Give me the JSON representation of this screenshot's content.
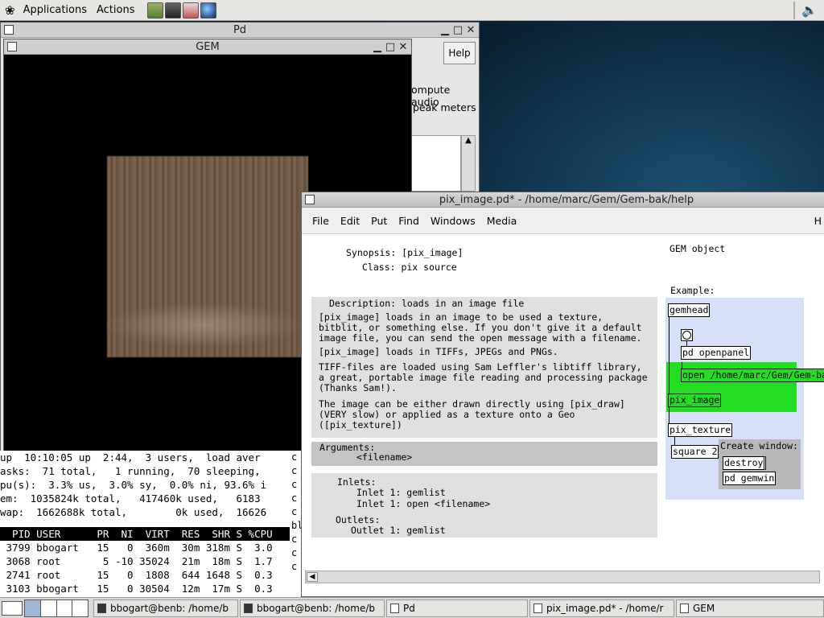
{
  "top_panel": {
    "applications": "Applications",
    "actions": "Actions",
    "launchers": [
      "notes-icon",
      "terminal-icon",
      "printer-icon",
      "globe-icon"
    ],
    "volume_icon": "speaker-icon"
  },
  "pd_window": {
    "title": "Pd",
    "help": "Help",
    "compute_audio": "ompute audio",
    "peak_meters": "peak meters"
  },
  "gem_window": {
    "title": "GEM"
  },
  "terminal": {
    "lines": [
      "up  10:10:05 up  2:44,  3 users,  load aver",
      "asks:  71 total,   1 running,  70 sleeping,",
      "pu(s):  3.3% us,  3.0% sy,  0.0% ni, 93.6% i",
      "em:  1035824k total,   417460k used,   6183",
      "wap:  1662688k total,        0k used,  16626"
    ],
    "header": "  PID USER      PR  NI  VIRT  RES  SHR S %CPU",
    "rows": [
      " 3799 bbogart   15   0  360m  30m 318m S  3.0",
      " 3068 root       5 -10 35024  21m  18m S  1.7",
      " 2741 root      15   0  1808  644 1648 S  0.3",
      " 3103 bbogart   15   0 30504  12m  17m S  0.3"
    ],
    "side_chars": [
      "c",
      "c",
      "c",
      "c",
      "c",
      "bl",
      "c",
      "c",
      "c"
    ]
  },
  "help_window": {
    "title": "pix_image.pd* - /home/marc/Gem/Gem-bak/help",
    "menu": [
      "File",
      "Edit",
      "Put",
      "Find",
      "Windows",
      "Media"
    ],
    "menu_extra": "H",
    "synopsis": "Synopsis: [pix_image]",
    "class": "Class: pix source",
    "gem_object": "GEM object",
    "description_title": "Description: loads in an image file",
    "desc_p1": "[pix_image] loads in an image to be used a texture,\nbitblit, or something else. If you don't give it a default\nimage file, you can send the open message with a filename.",
    "desc_p2": "[pix_image] loads in TIFFs, JPEGs and PNGs.",
    "desc_p3": "TIFF-files are loaded using Sam Leffler's libtiff library,\na great, portable image file reading and processing package\n(Thanks Sam!).",
    "desc_p4": "The image can be either drawn directly using [pix_draw]\n(VERY slow) or applied as a texture onto a Geo\n([pix_texture])",
    "arguments_title": "Arguments:",
    "arguments_value": "<filename>",
    "inlets_title": "Inlets:",
    "inlet_1a": "Inlet 1: gemlist",
    "inlet_1b": "Inlet 1: open <filename>",
    "outlets_title": "Outlets:",
    "outlet_1": "Outlet 1: gemlist",
    "example": "Example:",
    "patch": {
      "gemhead": "gemhead",
      "openpanel": "pd openpanel",
      "open_msg": "open /home/marc/Gem/Gem-ba",
      "pix_image": "pix_image",
      "pix_texture": "pix_texture",
      "square": "square 2",
      "create_window": "Create window:",
      "destroy": "destroy",
      "pd_gemwin": "pd gemwin"
    },
    "highlight_color": "#22dd22",
    "example_bg": "#d6e0f8"
  },
  "taskbar": {
    "items": [
      "bbogart@benb: /home/b",
      "bbogart@benb: /home/b",
      "Pd",
      "pix_image.pd* - /home/r",
      "GEM"
    ]
  }
}
